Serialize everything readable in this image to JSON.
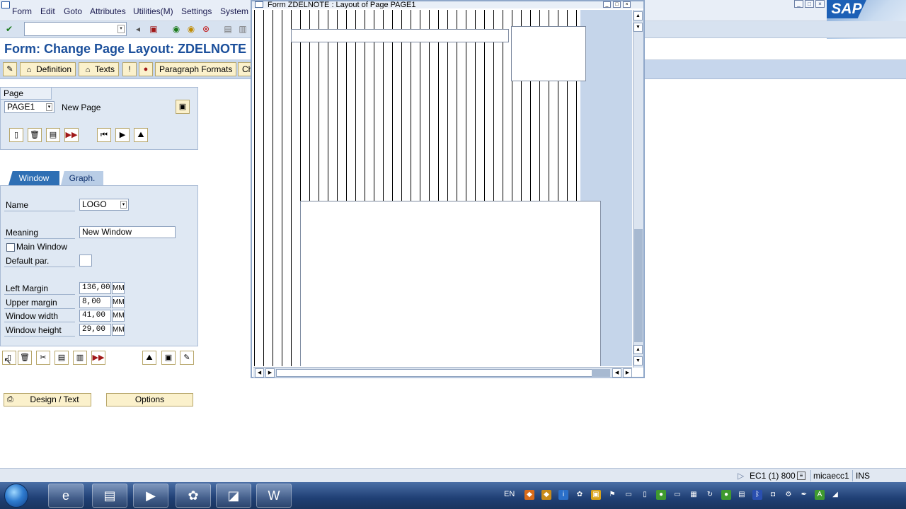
{
  "menu": {
    "items": [
      "Form",
      "Edit",
      "Goto",
      "Attributes",
      "Utilities(M)",
      "Settings",
      "System"
    ]
  },
  "brand": {
    "logo_text": "SAP"
  },
  "title": "Form: Change Page Layout: ZDELNOTE",
  "app_toolbar": {
    "definition_label": "Definition",
    "texts_label": "Texts",
    "paragraph_formats_label": "Paragraph Formats",
    "truncated_label": "Ch"
  },
  "page_section": {
    "header": "Page",
    "page_value": "PAGE1",
    "page_description": "New Page"
  },
  "tabs": {
    "window_label": "Window",
    "graph_label": "Graph."
  },
  "window_section": {
    "name_label": "Name",
    "name_value": "LOGO",
    "meaning_label": "Meaning",
    "meaning_value": "New Window",
    "main_window_label": "Main Window",
    "default_par_label": "Default par.",
    "left_margin_label": "Left Margin",
    "left_margin_value": "136,00",
    "upper_margin_label": "Upper margin",
    "upper_margin_value": "8,00",
    "window_width_label": "Window width",
    "window_width_value": "41,00",
    "window_height_label": "Window height",
    "window_height_value": "29,00",
    "unit": "MM"
  },
  "bottom_buttons": {
    "design_text_label": "Design / Text",
    "options_label": "Options"
  },
  "popup": {
    "title": "Form ZDELNOTE : Layout of Page PAGE1"
  },
  "status_bar": {
    "system": "EC1 (1) 800",
    "server": "micaecc1",
    "mode": "INS"
  },
  "taskbar": {
    "language": "EN"
  },
  "colors": {
    "title_blue": "#1b4f9b",
    "button_yellow": "#fbf1cc",
    "panel_blue": "#dfe8f3",
    "active_tab": "#2e6fb4"
  }
}
